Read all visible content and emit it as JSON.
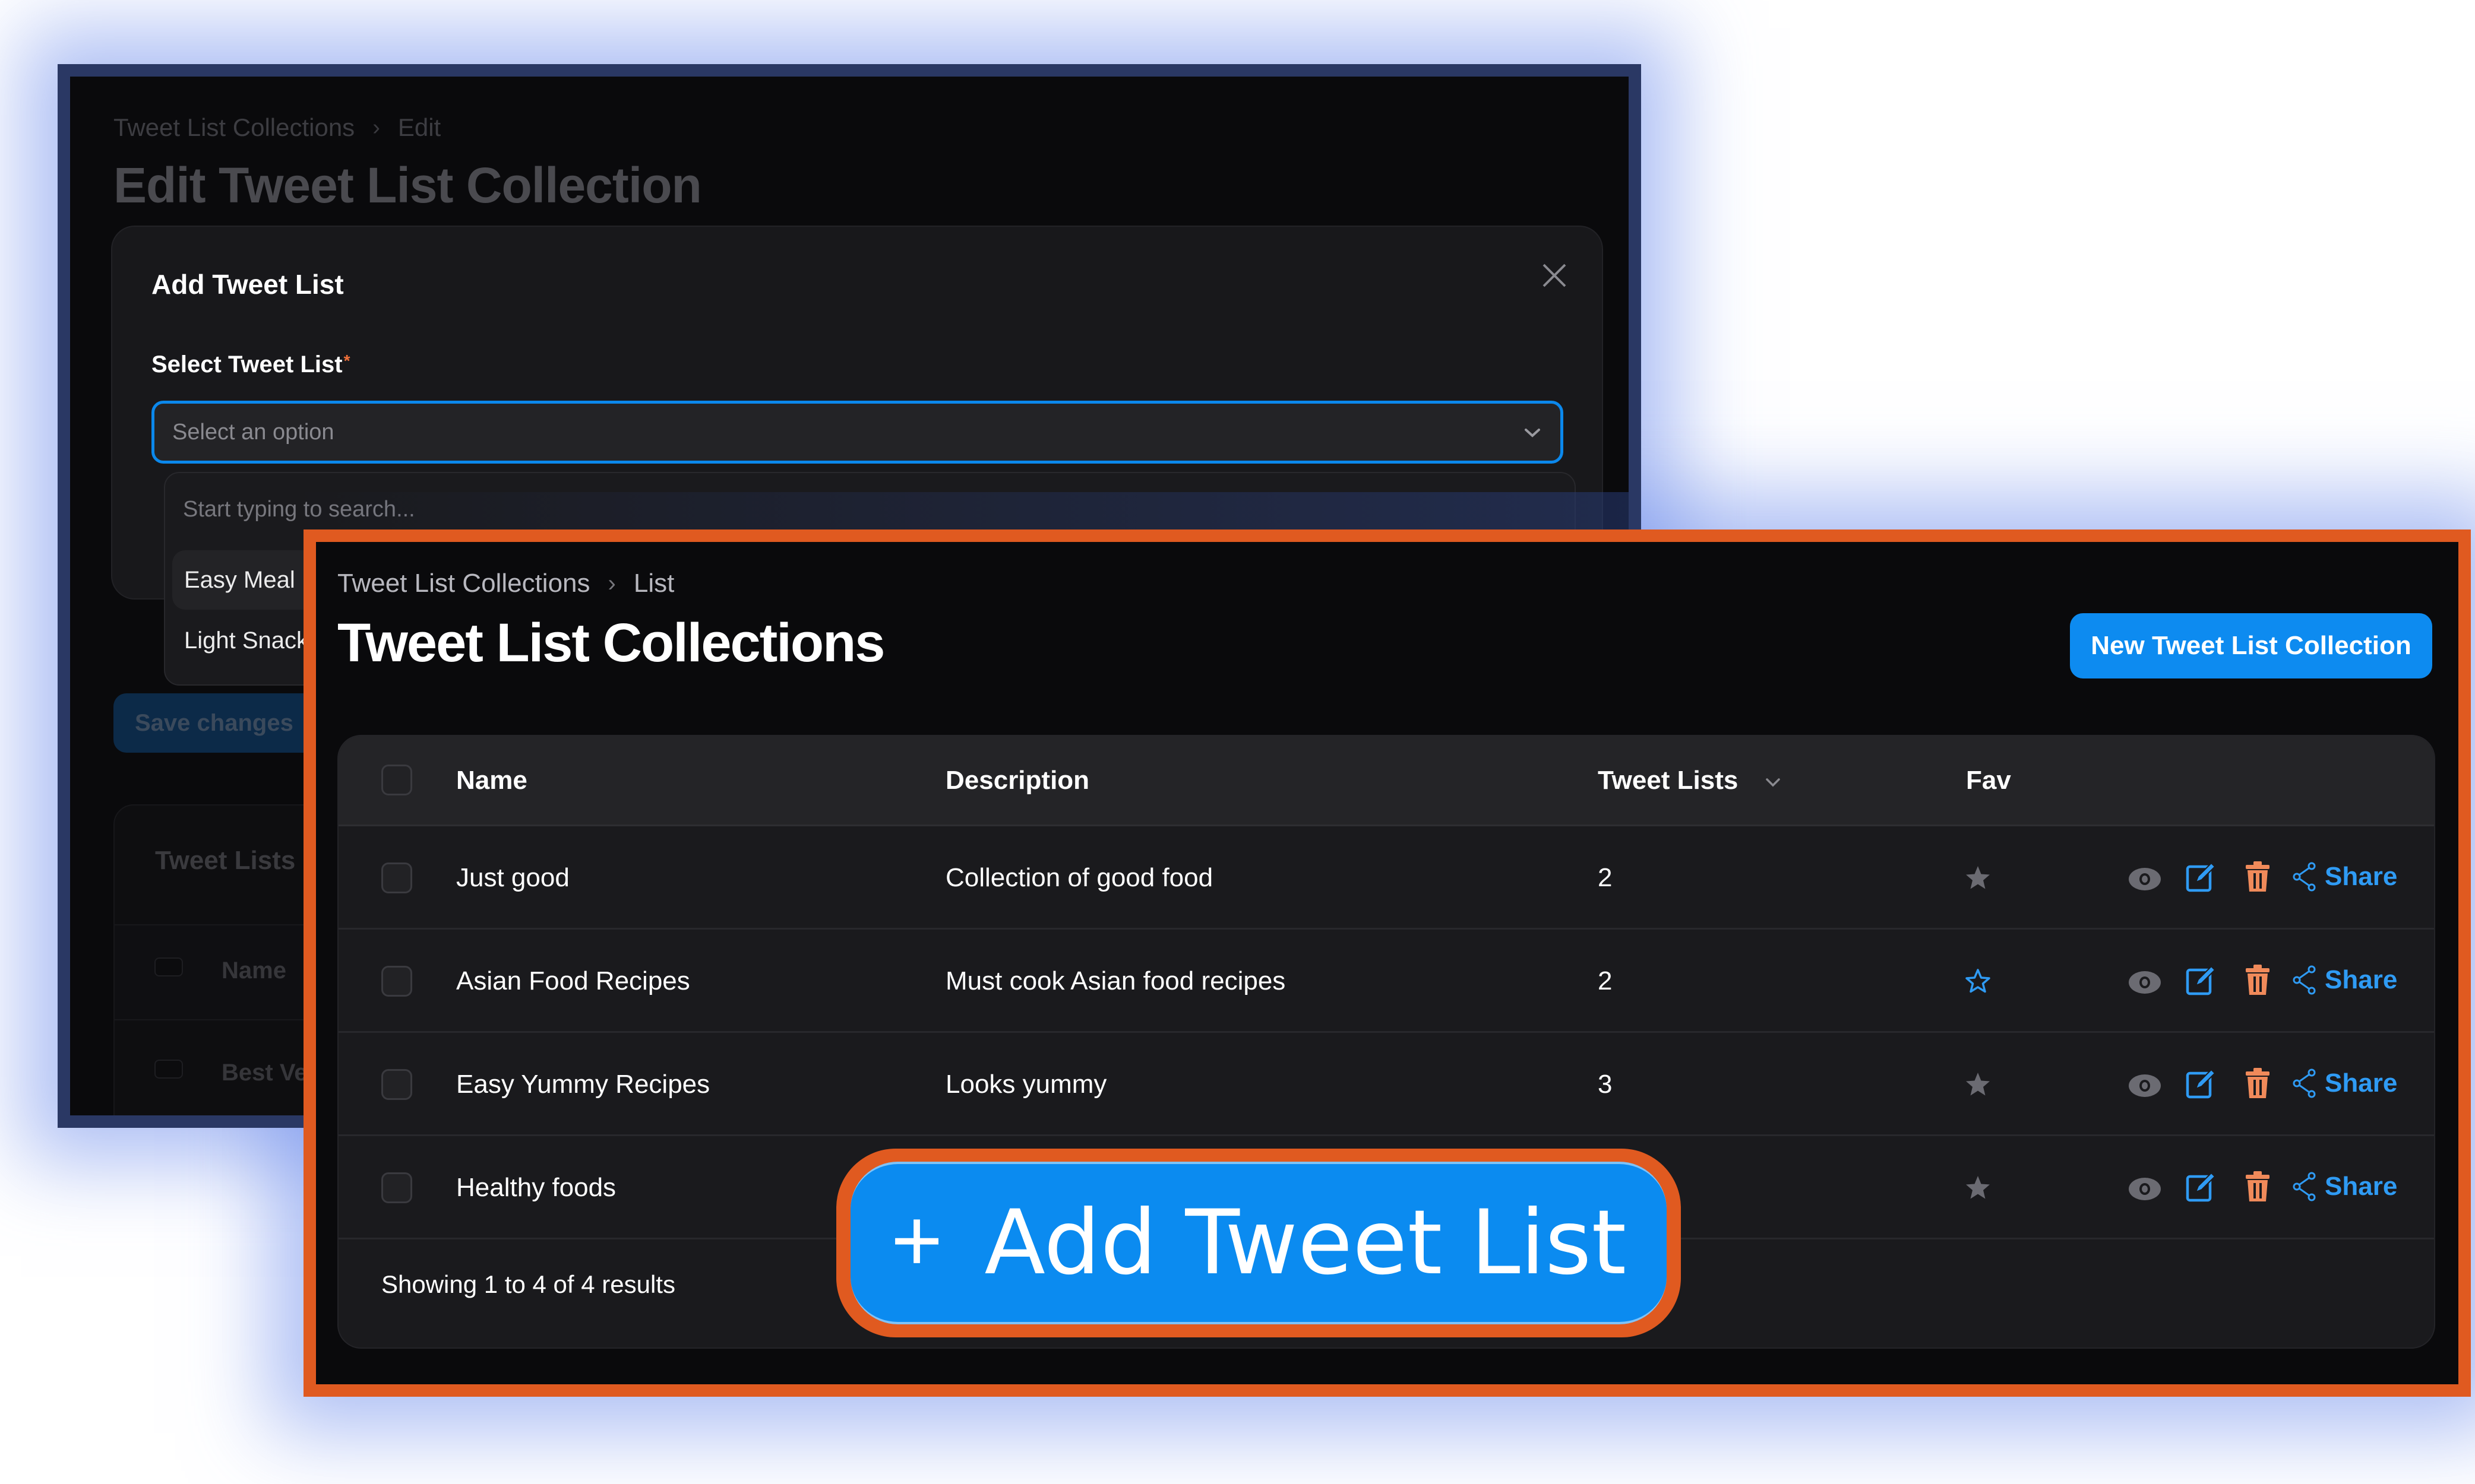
{
  "back_page": {
    "breadcrumb": [
      "Tweet List Collections",
      "Edit"
    ],
    "title": "Edit Tweet List Collection",
    "modal": {
      "title": "Add Tweet List",
      "field_label": "Select Tweet List",
      "required_marker": "*",
      "select_placeholder": "Select an option",
      "search_placeholder": "Start typing to search...",
      "options": [
        "Easy Meal P",
        "Light Snack"
      ]
    },
    "save_button": "Save changes",
    "tweet_lists_card": {
      "title": "Tweet Lists",
      "header": "Name",
      "rows": [
        "Best Ve"
      ]
    }
  },
  "front_page": {
    "breadcrumb": [
      "Tweet List Collections",
      "List"
    ],
    "title": "Tweet List Collections",
    "new_button": "New Tweet List Collection",
    "table": {
      "columns": [
        "Name",
        "Description",
        "Tweet Lists",
        "Fav"
      ],
      "sorted_column": "Tweet Lists",
      "rows": [
        {
          "name": "Just good",
          "description": "Collection of good food",
          "tweet_lists": "2",
          "fav": "filled"
        },
        {
          "name": "Asian Food Recipes",
          "description": "Must cook Asian food recipes",
          "tweet_lists": "2",
          "fav": "outline"
        },
        {
          "name": "Easy Yummy Recipes",
          "description": "Looks yummy",
          "tweet_lists": "3",
          "fav": "filled"
        },
        {
          "name": "Healthy foods",
          "description": "",
          "tweet_lists": "",
          "fav": "filled"
        }
      ],
      "row_actions": {
        "view": "eye-icon",
        "edit": "edit-icon",
        "delete": "trash-icon",
        "share_label": "Share"
      },
      "footer": "Showing 1 to 4 of 4 results"
    }
  },
  "callout": {
    "icon": "plus-icon",
    "label": "Add Tweet List"
  },
  "colors": {
    "accent_blue": "#0d8bf0",
    "highlight_orange": "#e05a20",
    "back_frame_navy": "#2a3864",
    "delete_orange": "#f08a5a",
    "share_blue": "#2f9bf4",
    "star_gray": "#6b6b72"
  }
}
